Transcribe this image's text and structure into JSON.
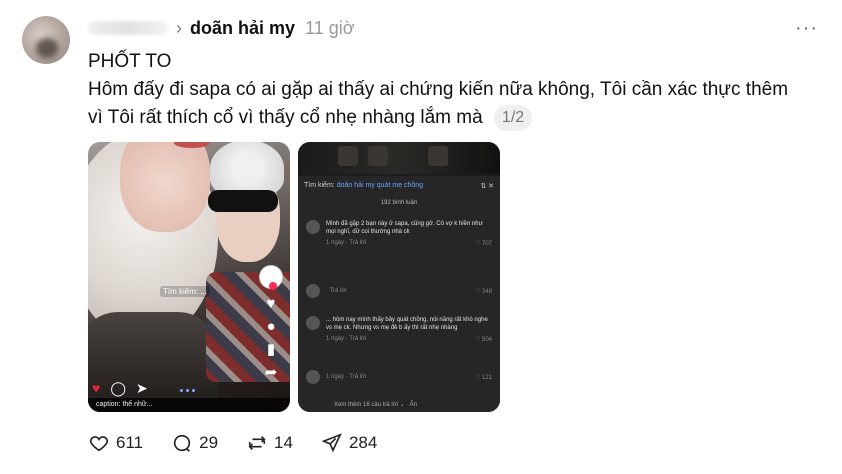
{
  "post": {
    "author_name": "doãn hải my",
    "time": "11 giờ",
    "title": "PHỐT TO",
    "body": "Hôm đấy đi sapa có ai gặp ai thấy ai chứng kiến nữa không, Tôi cần xác thực thêm vì Tôi rất thích cổ vì thấy cổ nhẹ nhàng lắm mà",
    "pager": "1/2"
  },
  "media1": {
    "search_tag": "Tìm kiếm: ...",
    "side_counts": [
      "",
      "",
      "",
      ""
    ],
    "caption": "caption: thế nhữ..."
  },
  "media2": {
    "search_prefix": "Tìm kiếm:",
    "search_query": "doãn hải my quát mẹ chồng",
    "comment_count": "192 bình luận",
    "comments": [
      {
        "text": "Mình đã gặp 2 bạn này ở sapa, cũng gở. Cô vợ k hiền như mọi nghĩ, dữ coi thường nhà ck",
        "time": "1 ngày",
        "reply": "Trả lời",
        "likes": "707"
      },
      {
        "text": "",
        "time": "",
        "reply": "Trả lời",
        "likes": "348"
      },
      {
        "text": "... hôm nay mình thấy bảy quát chồng, nói năng rất khó nghe vs mẹ ck. Nhưng vs mẹ đẻ b ấy thì rất nhẹ nhàng",
        "time": "1 ngày",
        "reply": "Trả lời",
        "likes": "504"
      },
      {
        "text": "",
        "time": "1 ngày",
        "reply": "Trả lời",
        "likes": "121"
      }
    ],
    "more_replies": "Xem thêm 16 câu trả lời",
    "hide": "Ẩn"
  },
  "actions": {
    "likes": "611",
    "comments": "29",
    "reposts": "14",
    "shares": "284"
  },
  "icons": [
    "more-icon",
    "chevron-right-icon",
    "heart-icon",
    "comment-icon",
    "repost-icon",
    "share-icon"
  ]
}
